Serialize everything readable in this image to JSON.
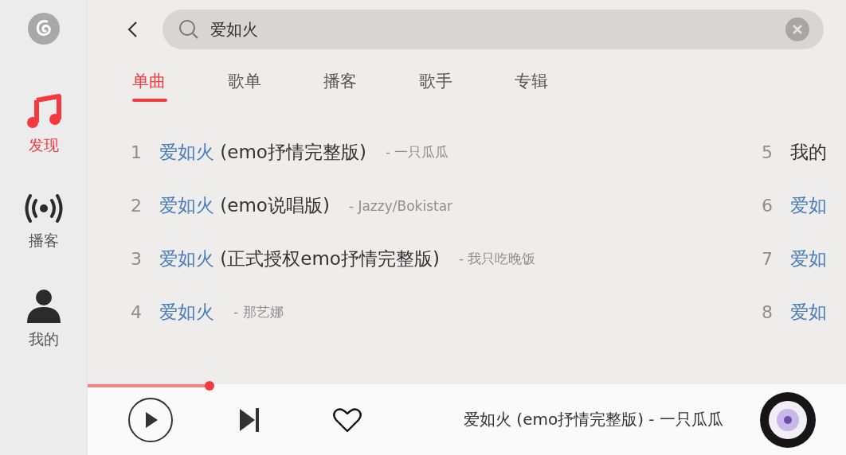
{
  "sidebar": {
    "items": [
      {
        "label": "发现",
        "kind": "music",
        "selected": true
      },
      {
        "label": "播客",
        "kind": "broadcast",
        "selected": false
      },
      {
        "label": "我的",
        "kind": "person",
        "selected": false
      }
    ]
  },
  "search": {
    "value": "爱如火"
  },
  "tabs": [
    {
      "label": "单曲",
      "selected": true
    },
    {
      "label": "歌单",
      "selected": false
    },
    {
      "label": "播客",
      "selected": false
    },
    {
      "label": "歌手",
      "selected": false
    },
    {
      "label": "专辑",
      "selected": false
    }
  ],
  "results": [
    {
      "index": "1",
      "match": "爱如火",
      "rest": " (emo抒情完整版)",
      "artist": "- 一只瓜瓜"
    },
    {
      "index": "2",
      "match": "爱如火",
      "rest": " (emo说唱版)",
      "artist": "- Jazzy/Bokistar"
    },
    {
      "index": "3",
      "match": "爱如火",
      "rest": " (正式授权emo抒情完整版)",
      "artist": "- 我只吃晚饭"
    },
    {
      "index": "4",
      "match": "爱如火",
      "artist": "- 那艺娜"
    },
    {
      "index": "5",
      "rest": "我的"
    },
    {
      "index": "6",
      "match": "爱如"
    },
    {
      "index": "7",
      "match": "爱如"
    },
    {
      "index": "8",
      "match": "爱如"
    }
  ],
  "player": {
    "level": 0.161,
    "liked": false,
    "now_playing": "爱如火 (emo抒情完整版) - 一只瓜瓜"
  }
}
